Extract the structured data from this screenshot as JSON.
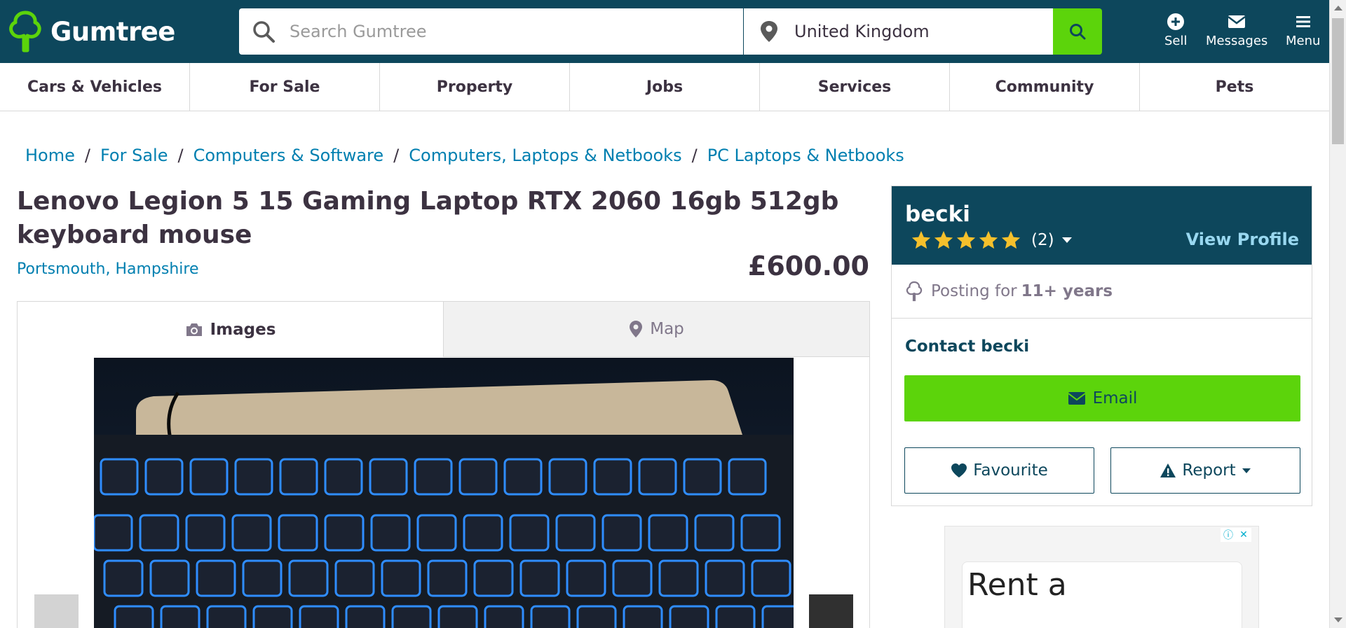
{
  "header": {
    "logo_text": "Gumtree",
    "search_placeholder": "Search Gumtree",
    "location": "United Kingdom",
    "actions": {
      "sell": "Sell",
      "messages": "Messages",
      "menu": "Menu"
    }
  },
  "categories": [
    "Cars & Vehicles",
    "For Sale",
    "Property",
    "Jobs",
    "Services",
    "Community",
    "Pets"
  ],
  "breadcrumb": [
    "Home",
    "For Sale",
    "Computers & Software",
    "Computers, Laptops & Netbooks",
    "PC Laptops & Netbooks"
  ],
  "breadcrumb_sep": "/",
  "listing": {
    "title": "Lenovo Legion 5 15 Gaming Laptop RTX 2060 16gb 512gb keyboard mouse",
    "location": "Portsmouth, Hampshire",
    "price": "£600.00",
    "tabs": {
      "images": "Images",
      "map": "Map"
    }
  },
  "seller": {
    "name": "becki",
    "rating_stars": 5,
    "review_count": "(2)",
    "view_profile": "View Profile",
    "posting_prefix": "Posting for",
    "posting_duration": "11+ years",
    "contact_label": "Contact becki",
    "email_button": "Email",
    "favourite_button": "Favourite",
    "report_button": "Report"
  },
  "ad": {
    "text": "Rent a"
  },
  "colors": {
    "brand_dark": "#0d475c",
    "brand_green": "#5cd40b",
    "link_blue": "#007fb0",
    "star_yellow": "#f5c02c"
  }
}
